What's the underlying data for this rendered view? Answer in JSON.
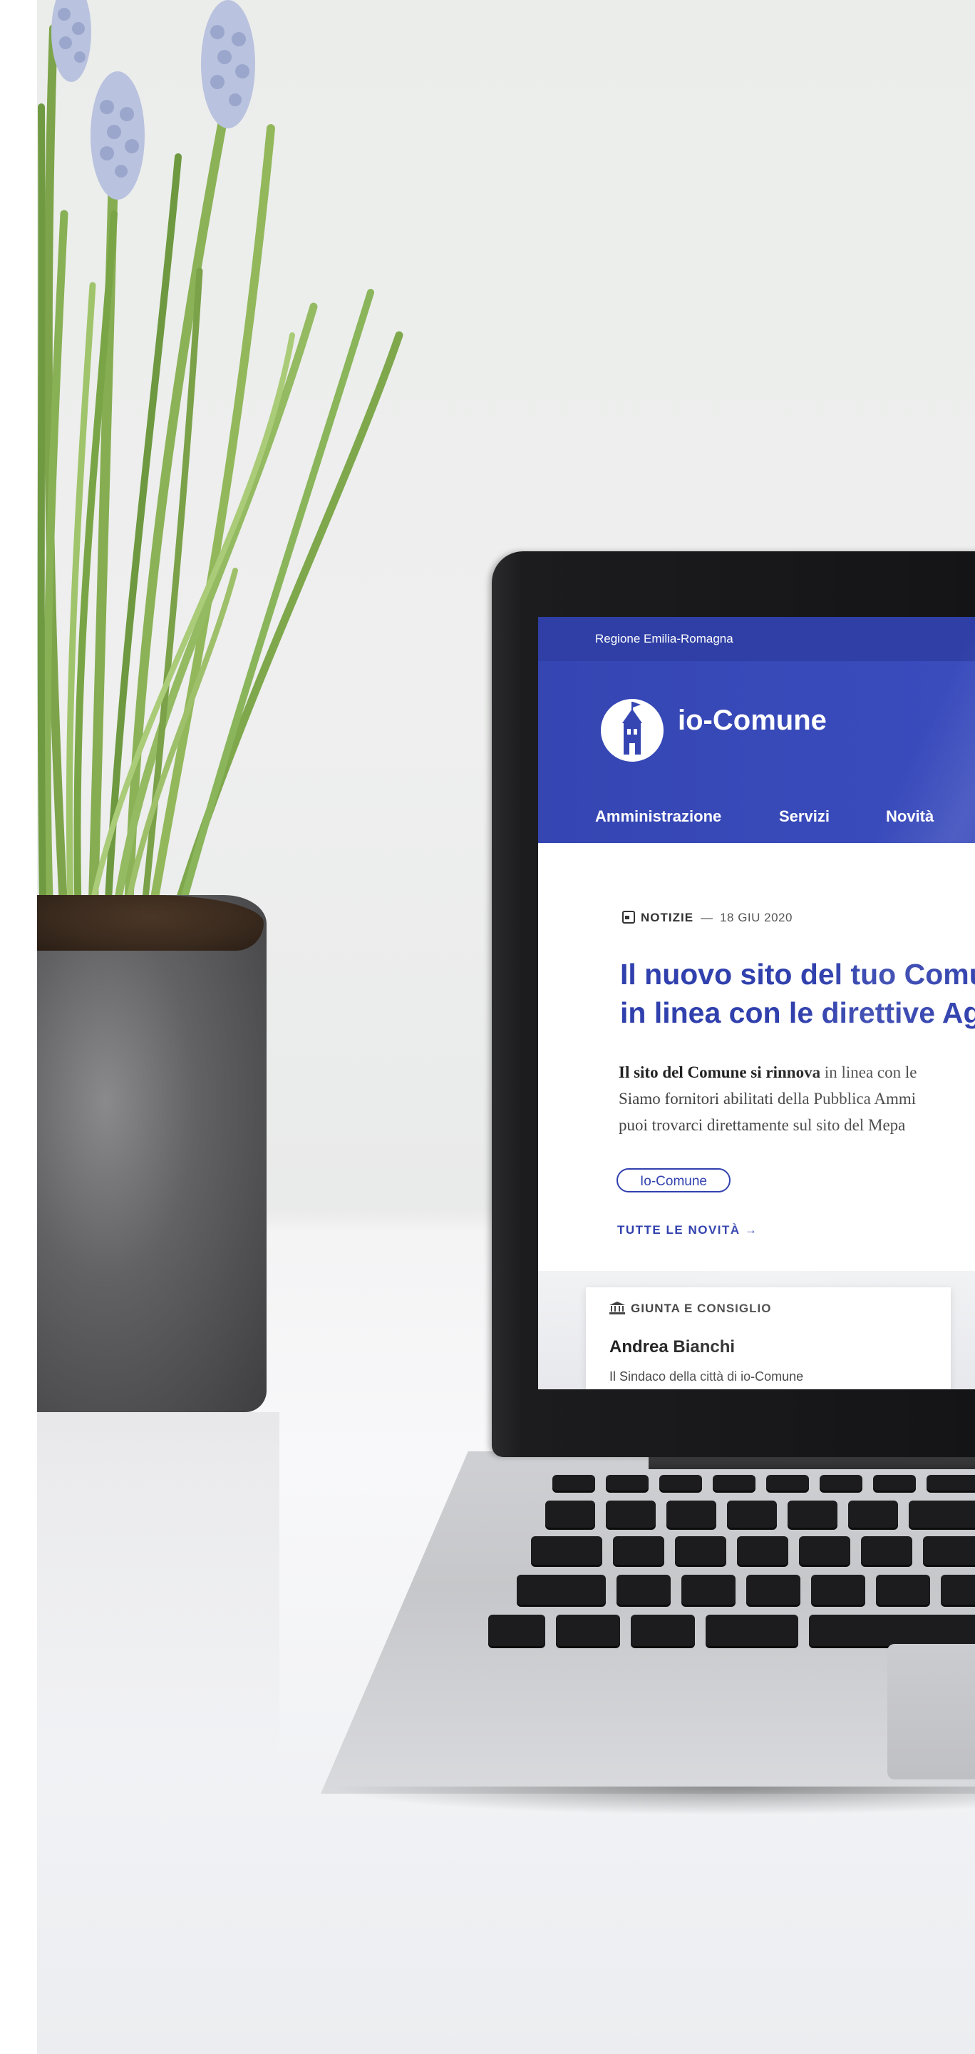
{
  "screen": {
    "region": "Regione Emilia-Romagna",
    "brand": "io-Comune",
    "nav": [
      "Amministrazione",
      "Servizi",
      "Novità"
    ],
    "article": {
      "category": "NOTIZIE",
      "separator": "—",
      "date": "18 GIU 2020",
      "headline_line1": "Il nuovo sito del tuo Comun",
      "headline_line2": "in linea con le direttive Agi",
      "body_bold": "Il sito del Comune si rinnova",
      "body_line1_rest": " in linea con le",
      "body_line2": "Siamo fornitori abilitati della Pubblica Ammi",
      "body_line3": "puoi trovarci direttamente sul sito del Mepa",
      "tag": "Io-Comune",
      "more_link": "TUTTE LE NOVITÀ  →"
    },
    "card": {
      "category": "GIUNTA E CONSIGLIO",
      "title": "Andrea Bianchi",
      "subtitle": "Il Sindaco della città di io-Comune"
    }
  },
  "colors": {
    "brand_blue": "#3040ad",
    "header_blue": "#3546b3"
  }
}
